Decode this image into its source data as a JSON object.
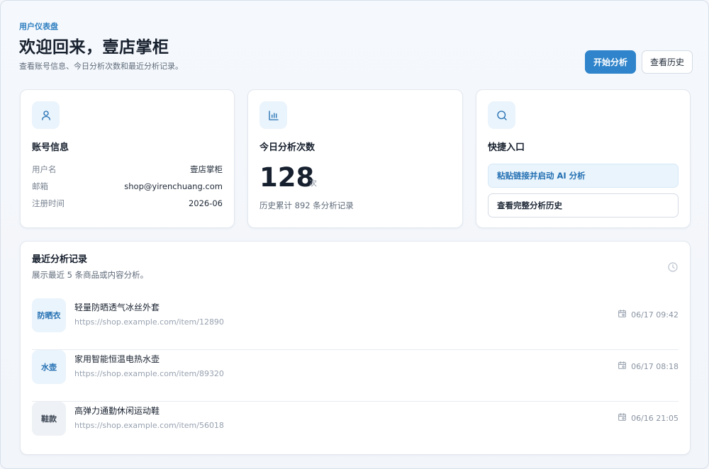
{
  "header": {
    "eyebrow": "用户仪表盘",
    "title": "欢迎回来，壹店掌柜",
    "subtitle": "查看账号信息、今日分析次数和最近分析记录。",
    "primary_button": "开始分析",
    "secondary_button": "查看历史"
  },
  "account": {
    "icon": "user-icon",
    "title": "账号信息",
    "fields": [
      {
        "label": "用户名",
        "value": "壹店掌柜"
      },
      {
        "label": "邮箱",
        "value": "shop@yirenchuang.com"
      },
      {
        "label": "注册时间",
        "value": "2026-06"
      }
    ]
  },
  "today": {
    "icon": "bar-chart-icon",
    "title": "今日分析次数",
    "count": "128",
    "unit": "次",
    "history": "历史累计 892 条分析记录"
  },
  "quick": {
    "icon": "search-icon",
    "title": "快捷入口",
    "primary": "粘贴链接并启动 AI 分析",
    "secondary": "查看完整分析历史"
  },
  "recent": {
    "title": "最近分析记录",
    "subtitle": "展示最近 5 条商品或内容分析。",
    "icon": "clock-icon",
    "items": [
      {
        "tag": "防晒衣",
        "name": "轻量防晒透气冰丝外套",
        "url": "https://shop.example.com/item/12890",
        "time": "06/17 09:42"
      },
      {
        "tag": "水壶",
        "name": "家用智能恒温电热水壶",
        "url": "https://shop.example.com/item/89320",
        "time": "06/17 08:18"
      },
      {
        "tag": "鞋款",
        "name": "高弹力通勤休闲运动鞋",
        "url": "https://shop.example.com/item/56018",
        "time": "06/16 21:05"
      }
    ]
  },
  "colors": {
    "accent": "#2f84cb",
    "accent_soft": "#eaf4fc",
    "text": "#17202e",
    "muted": "#5f6b7a"
  }
}
